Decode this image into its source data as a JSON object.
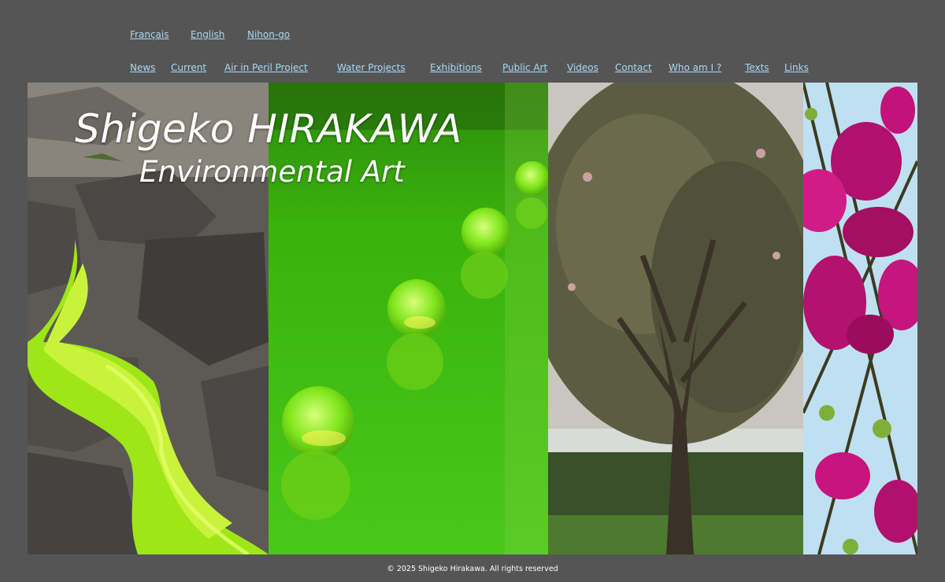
{
  "language_nav": [
    {
      "label": "Français"
    },
    {
      "label": "English"
    },
    {
      "label": "Nihon-go"
    }
  ],
  "main_nav": [
    {
      "label": "News"
    },
    {
      "label": "Current"
    },
    {
      "label": "Air in Peril Project"
    },
    {
      "label": "Water Projects"
    },
    {
      "label": "Exhibitions"
    },
    {
      "label": "Public Art"
    },
    {
      "label": "Videos"
    },
    {
      "label": "Contact"
    },
    {
      "label": "Who am I ?"
    },
    {
      "label": "Texts"
    },
    {
      "label": "Links"
    }
  ],
  "banner": {
    "title": "Shigeko HIRAKAWA",
    "subtitle": "Environmental Art"
  },
  "footer": {
    "copyright": "© 2025 Shigeko Hirakawa. All rights reserved"
  },
  "colors": {
    "background": "#555555",
    "link": "#a9d8f5",
    "text": "#ffffff"
  }
}
